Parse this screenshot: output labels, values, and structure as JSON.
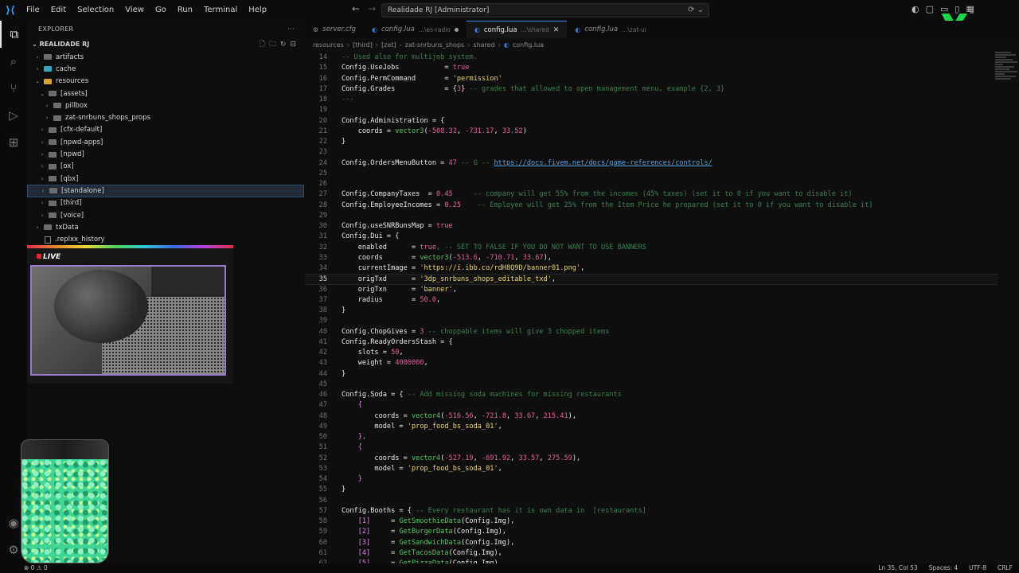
{
  "titlebar": {
    "menu": [
      "File",
      "Edit",
      "Selection",
      "View",
      "Go",
      "Run",
      "Terminal",
      "Help"
    ],
    "search_text": "Realidade RJ [Administrator]"
  },
  "sidebar": {
    "title": "EXPLORER",
    "section": "REALIDADE RJ",
    "tree": [
      {
        "label": "artifacts",
        "depth": 0,
        "chev": "›",
        "kind": "folder",
        "color": "gray"
      },
      {
        "label": "cache",
        "depth": 0,
        "chev": "›",
        "kind": "folder",
        "color": "cyan"
      },
      {
        "label": "resources",
        "depth": 0,
        "chev": "⌄",
        "kind": "folder",
        "color": "orange"
      },
      {
        "label": "[assets]",
        "depth": 1,
        "chev": "⌄",
        "kind": "folder",
        "color": "gray"
      },
      {
        "label": "pillbox",
        "depth": 2,
        "chev": "›",
        "kind": "folder",
        "color": "gray"
      },
      {
        "label": "zat-snrbuns_shops_props",
        "depth": 2,
        "chev": "›",
        "kind": "folder",
        "color": "gray"
      },
      {
        "label": "[cfx-default]",
        "depth": 1,
        "chev": "›",
        "kind": "folder",
        "color": "gray"
      },
      {
        "label": "[npwd-apps]",
        "depth": 1,
        "chev": "›",
        "kind": "folder",
        "color": "gray"
      },
      {
        "label": "[npwd]",
        "depth": 1,
        "chev": "›",
        "kind": "folder",
        "color": "gray"
      },
      {
        "label": "[ox]",
        "depth": 1,
        "chev": "›",
        "kind": "folder",
        "color": "gray"
      },
      {
        "label": "[qbx]",
        "depth": 1,
        "chev": "›",
        "kind": "folder",
        "color": "gray"
      },
      {
        "label": "[standalone]",
        "depth": 1,
        "chev": "›",
        "kind": "folder",
        "color": "gray",
        "selected": true
      },
      {
        "label": "[third]",
        "depth": 1,
        "chev": "›",
        "kind": "folder",
        "color": "gray"
      },
      {
        "label": "[voice]",
        "depth": 1,
        "chev": "›",
        "kind": "folder",
        "color": "gray"
      },
      {
        "label": "txData",
        "depth": 0,
        "chev": "›",
        "kind": "folder",
        "color": "gray"
      },
      {
        "label": ".replxx_history",
        "depth": 0,
        "chev": "",
        "kind": "file",
        "color": "gray"
      }
    ]
  },
  "webcam": {
    "live_label": "LIVE"
  },
  "tabs": [
    {
      "icon": "cfg",
      "name": "server.cfg",
      "desc": "",
      "active": false,
      "modified": false
    },
    {
      "icon": "lua",
      "name": "config.lua",
      "desc": "...\\es-radio",
      "active": false,
      "modified": true
    },
    {
      "icon": "lua",
      "name": "config.lua",
      "desc": "...\\shared",
      "active": true,
      "modified": false
    },
    {
      "icon": "lua",
      "name": "config.lua",
      "desc": "...\\zat-ui",
      "active": false,
      "modified": false
    }
  ],
  "breadcrumb": [
    "resources",
    "[third]",
    "[zat]",
    "zat-snrbuns_shops",
    "shared",
    "config.lua"
  ],
  "code": [
    {
      "n": 14,
      "t": [
        [
          "c",
          "-- Used also for multijob system."
        ]
      ]
    },
    {
      "n": 15,
      "t": [
        [
          "k",
          "Config.UseJobs           = "
        ],
        [
          "n",
          "true"
        ]
      ]
    },
    {
      "n": 16,
      "t": [
        [
          "k",
          "Config.PermCommand       = "
        ],
        [
          "s",
          "'permission'"
        ]
      ]
    },
    {
      "n": 17,
      "t": [
        [
          "k",
          "Config.Grades            = {"
        ],
        [
          "n",
          "3"
        ],
        [
          "k",
          "} "
        ],
        [
          "c",
          "-- grades that allowed to open management menu, example {2, 3}"
        ]
      ]
    },
    {
      "n": 18,
      "t": [
        [
          "c",
          "---"
        ]
      ]
    },
    {
      "n": 19,
      "t": []
    },
    {
      "n": 20,
      "t": [
        [
          "k",
          "Config.Administration = {"
        ]
      ]
    },
    {
      "n": 21,
      "t": [
        [
          "k",
          "    coords = "
        ],
        [
          "f",
          "vector3"
        ],
        [
          "k",
          "("
        ],
        [
          "n",
          "-508.32"
        ],
        [
          "k",
          ", "
        ],
        [
          "n",
          "-731.17"
        ],
        [
          "k",
          ", "
        ],
        [
          "n",
          "33.52"
        ],
        [
          "k",
          ")"
        ]
      ]
    },
    {
      "n": 22,
      "t": [
        [
          "k",
          "}"
        ]
      ]
    },
    {
      "n": 23,
      "t": []
    },
    {
      "n": 24,
      "t": [
        [
          "k",
          "Config.OrdersMenuButton = "
        ],
        [
          "n",
          "47"
        ],
        [
          "c",
          " -- G -- "
        ],
        [
          "u",
          "https://docs.fivem.net/docs/game-references/controls/"
        ]
      ]
    },
    {
      "n": 25,
      "t": []
    },
    {
      "n": 26,
      "t": []
    },
    {
      "n": 27,
      "t": [
        [
          "k",
          "Config.CompanyTaxes  = "
        ],
        [
          "n",
          "0.45"
        ],
        [
          "c",
          "     -- company will get 55% from the incomes (45% taxes) (set it to 0 if you want to disable it)"
        ]
      ]
    },
    {
      "n": 28,
      "t": [
        [
          "k",
          "Config.EmployeeIncomes = "
        ],
        [
          "n",
          "0.25"
        ],
        [
          "c",
          "    -- Employee will get 25% from the Item Price he prepared (set it to 0 if you want to disable it)"
        ]
      ]
    },
    {
      "n": 29,
      "t": []
    },
    {
      "n": 30,
      "t": [
        [
          "k",
          "Config.useSNRBunsMap = "
        ],
        [
          "n",
          "true"
        ]
      ]
    },
    {
      "n": 31,
      "t": [
        [
          "k",
          "Config.Dui = {"
        ]
      ]
    },
    {
      "n": 32,
      "t": [
        [
          "k",
          "    enabled      = "
        ],
        [
          "n",
          "true"
        ],
        [
          "c",
          ", -- SET TO FALSE IF YOU DO NOT WANT TO USE BANNERS"
        ]
      ]
    },
    {
      "n": 33,
      "t": [
        [
          "k",
          "    coords       = "
        ],
        [
          "f",
          "vector3"
        ],
        [
          "k",
          "("
        ],
        [
          "n",
          "-513.6"
        ],
        [
          "k",
          ", "
        ],
        [
          "n",
          "-710.71"
        ],
        [
          "k",
          ", "
        ],
        [
          "n",
          "33.67"
        ],
        [
          "k",
          "),"
        ]
      ]
    },
    {
      "n": 34,
      "t": [
        [
          "k",
          "    currentImage = "
        ],
        [
          "s",
          "'https://i.ibb.co/rdH8Q9D/banner01.png'"
        ],
        [
          "k",
          ","
        ]
      ]
    },
    {
      "n": 35,
      "t": [
        [
          "k",
          "    origTxd      = "
        ],
        [
          "s",
          "'3dp_snrbuns_shops_editable_txd'"
        ],
        [
          "k",
          ","
        ]
      ],
      "current": true
    },
    {
      "n": 36,
      "t": [
        [
          "k",
          "    origTxn      = "
        ],
        [
          "s",
          "'banner'"
        ],
        [
          "k",
          ","
        ]
      ]
    },
    {
      "n": 37,
      "t": [
        [
          "k",
          "    radius       = "
        ],
        [
          "n",
          "50.0"
        ],
        [
          "k",
          ","
        ]
      ]
    },
    {
      "n": 38,
      "t": [
        [
          "k",
          "}"
        ]
      ]
    },
    {
      "n": 39,
      "t": []
    },
    {
      "n": 40,
      "t": [
        [
          "k",
          "Config.ChopGives = "
        ],
        [
          "n",
          "3"
        ],
        [
          "c",
          " -- choppable items will give 3 chopped items"
        ]
      ]
    },
    {
      "n": 41,
      "t": [
        [
          "k",
          "Config.ReadyOrdersStash = {"
        ]
      ]
    },
    {
      "n": 42,
      "t": [
        [
          "k",
          "    slots = "
        ],
        [
          "n",
          "50"
        ],
        [
          "k",
          ","
        ]
      ]
    },
    {
      "n": 43,
      "t": [
        [
          "k",
          "    weight = "
        ],
        [
          "n",
          "4000000"
        ],
        [
          "k",
          ","
        ]
      ]
    },
    {
      "n": 44,
      "t": [
        [
          "k",
          "}"
        ]
      ]
    },
    {
      "n": 45,
      "t": []
    },
    {
      "n": 46,
      "t": [
        [
          "k",
          "Config.Soda = { "
        ],
        [
          "c",
          "-- Add missing soda machines for missing restaurants"
        ]
      ]
    },
    {
      "n": 47,
      "t": [
        [
          "b",
          "    {"
        ]
      ]
    },
    {
      "n": 48,
      "t": [
        [
          "k",
          "        coords = "
        ],
        [
          "f",
          "vector4"
        ],
        [
          "k",
          "("
        ],
        [
          "n",
          "-516.56"
        ],
        [
          "k",
          ", "
        ],
        [
          "n",
          "-721.8"
        ],
        [
          "k",
          ", "
        ],
        [
          "n",
          "33.67"
        ],
        [
          "k",
          ", "
        ],
        [
          "n",
          "215.41"
        ],
        [
          "k",
          "),"
        ]
      ]
    },
    {
      "n": 49,
      "t": [
        [
          "k",
          "        model = "
        ],
        [
          "s",
          "'prop_food_bs_soda_01'"
        ],
        [
          "k",
          ","
        ]
      ]
    },
    {
      "n": 50,
      "t": [
        [
          "b",
          "    },"
        ]
      ]
    },
    {
      "n": 51,
      "t": [
        [
          "b",
          "    {"
        ]
      ]
    },
    {
      "n": 52,
      "t": [
        [
          "k",
          "        coords = "
        ],
        [
          "f",
          "vector4"
        ],
        [
          "k",
          "("
        ],
        [
          "n",
          "-527.19"
        ],
        [
          "k",
          ", "
        ],
        [
          "n",
          "-691.92"
        ],
        [
          "k",
          ", "
        ],
        [
          "n",
          "33.57"
        ],
        [
          "k",
          ", "
        ],
        [
          "n",
          "275.59"
        ],
        [
          "k",
          "),"
        ]
      ]
    },
    {
      "n": 53,
      "t": [
        [
          "k",
          "        model = "
        ],
        [
          "s",
          "'prop_food_bs_soda_01'"
        ],
        [
          "k",
          ","
        ]
      ]
    },
    {
      "n": 54,
      "t": [
        [
          "b",
          "    }"
        ]
      ]
    },
    {
      "n": 55,
      "t": [
        [
          "k",
          "}"
        ]
      ]
    },
    {
      "n": 56,
      "t": []
    },
    {
      "n": 57,
      "t": [
        [
          "k",
          "Config.Booths = { "
        ],
        [
          "c",
          "-- Every restaurant has it is own data in  [restaurants]"
        ]
      ]
    },
    {
      "n": 58,
      "t": [
        [
          "b",
          "    [1]"
        ],
        [
          "k",
          "     = "
        ],
        [
          "f",
          "GetSmoothieData"
        ],
        [
          "k",
          "(Config.Img),"
        ]
      ]
    },
    {
      "n": 59,
      "t": [
        [
          "b",
          "    [2]"
        ],
        [
          "k",
          "     = "
        ],
        [
          "f",
          "GetBurgerData"
        ],
        [
          "k",
          "(Config.Img),"
        ]
      ]
    },
    {
      "n": 60,
      "t": [
        [
          "b",
          "    [3]"
        ],
        [
          "k",
          "     = "
        ],
        [
          "f",
          "GetSandwichData"
        ],
        [
          "k",
          "(Config.Img),"
        ]
      ]
    },
    {
      "n": 61,
      "t": [
        [
          "b",
          "    [4]"
        ],
        [
          "k",
          "     = "
        ],
        [
          "f",
          "GetTacosData"
        ],
        [
          "k",
          "(Config.Img),"
        ]
      ]
    },
    {
      "n": 62,
      "t": [
        [
          "b",
          "    [5]"
        ],
        [
          "k",
          "     = "
        ],
        [
          "f",
          "GetPizzaData"
        ],
        [
          "k",
          "(Config.Img),"
        ]
      ]
    }
  ],
  "statusbar": {
    "left": "⊗ 0 ⚠ 0",
    "right": [
      "Ln 35, Col 53",
      "Spaces: 4",
      "UTF-8",
      "CRLF"
    ]
  }
}
